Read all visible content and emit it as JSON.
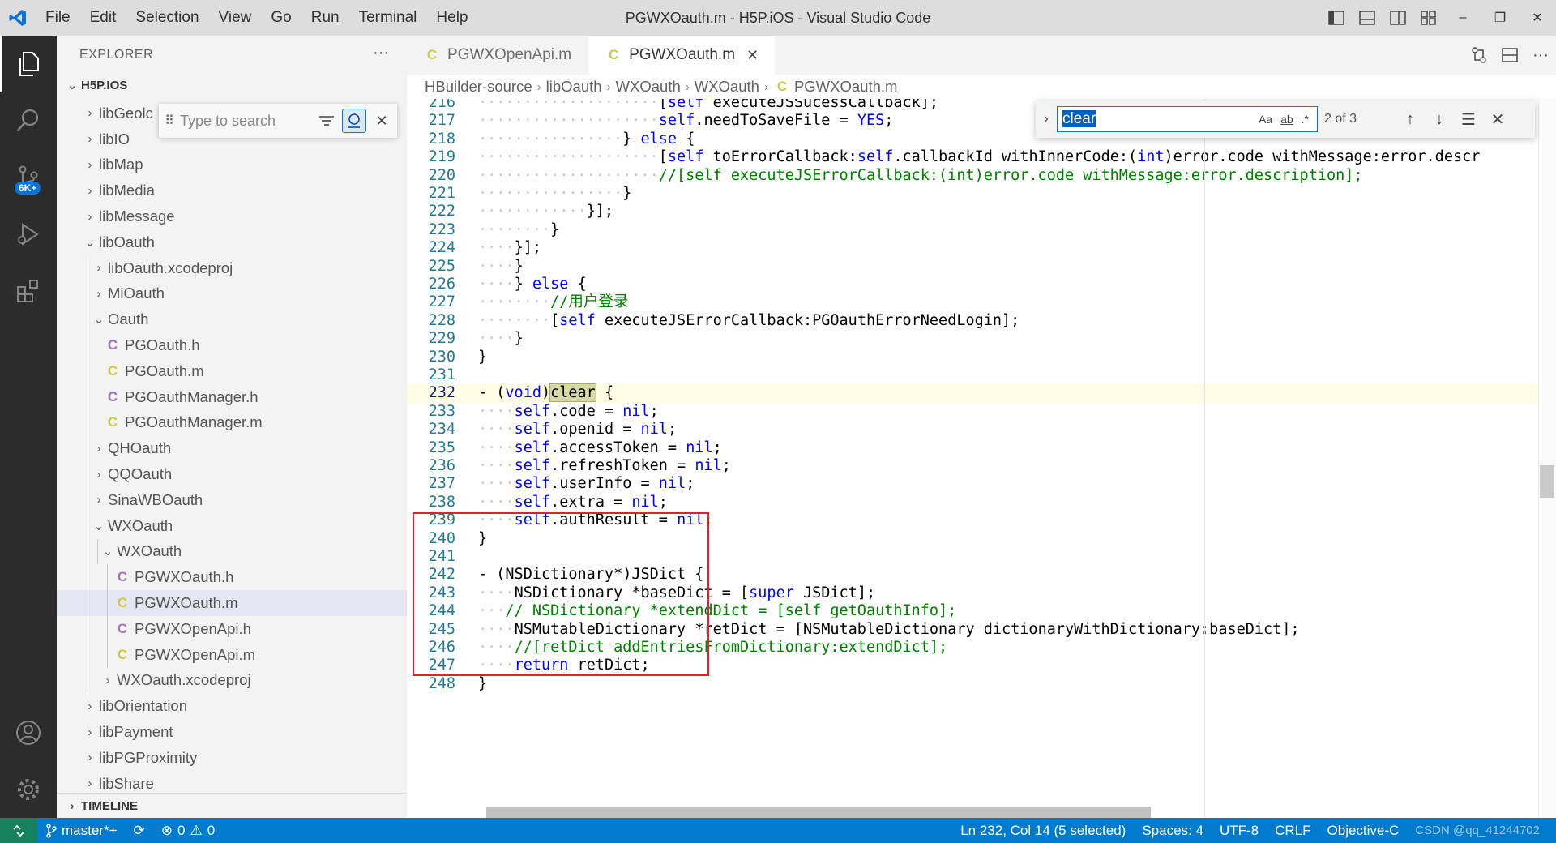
{
  "window": {
    "title": "PGWXOauth.m - H5P.iOS - Visual Studio Code",
    "menu": [
      "File",
      "Edit",
      "Selection",
      "View",
      "Go",
      "Run",
      "Terminal",
      "Help"
    ],
    "controls": {
      "minimize": "–",
      "restore": "❐",
      "close": "✕"
    }
  },
  "activity_bar": {
    "scm_badge": "6K+"
  },
  "sidebar": {
    "title": "EXPLORER",
    "more": "···",
    "root": "H5P.IOS",
    "find": {
      "placeholder": "Type to search"
    },
    "items": [
      {
        "label": "libGeolc",
        "chevron": "›",
        "icon": ""
      },
      {
        "label": "libIO",
        "chevron": "›",
        "icon": ""
      },
      {
        "label": "libMap",
        "chevron": "›",
        "icon": ""
      },
      {
        "label": "libMedia",
        "chevron": "›",
        "icon": ""
      },
      {
        "label": "libMessage",
        "chevron": "›",
        "icon": ""
      },
      {
        "label": "libOauth",
        "chevron": "⌄",
        "icon": ""
      },
      {
        "label": "libOauth.xcodeproj",
        "chevron": "›",
        "icon": ""
      },
      {
        "label": "MiOauth",
        "chevron": "›",
        "icon": ""
      },
      {
        "label": "Oauth",
        "chevron": "⌄",
        "icon": ""
      },
      {
        "label": "PGOauth.h",
        "chevron": "",
        "icon": "C"
      },
      {
        "label": "PGOauth.m",
        "chevron": "",
        "icon": "C"
      },
      {
        "label": "PGOauthManager.h",
        "chevron": "",
        "icon": "C"
      },
      {
        "label": "PGOauthManager.m",
        "chevron": "",
        "icon": "C"
      },
      {
        "label": "QHOauth",
        "chevron": "›",
        "icon": ""
      },
      {
        "label": "QQOauth",
        "chevron": "›",
        "icon": ""
      },
      {
        "label": "SinaWBOauth",
        "chevron": "›",
        "icon": ""
      },
      {
        "label": "WXOauth",
        "chevron": "⌄",
        "icon": ""
      },
      {
        "label": "WXOauth",
        "chevron": "⌄",
        "icon": ""
      },
      {
        "label": "PGWXOauth.h",
        "chevron": "",
        "icon": "C"
      },
      {
        "label": "PGWXOauth.m",
        "chevron": "",
        "icon": "C"
      },
      {
        "label": "PGWXOpenApi.h",
        "chevron": "",
        "icon": "C"
      },
      {
        "label": "PGWXOpenApi.m",
        "chevron": "",
        "icon": "C"
      },
      {
        "label": "WXOauth.xcodeproj",
        "chevron": "›",
        "icon": ""
      },
      {
        "label": "libOrientation",
        "chevron": "›",
        "icon": ""
      },
      {
        "label": "libPayment",
        "chevron": "›",
        "icon": ""
      },
      {
        "label": "libPGProximity",
        "chevron": "›",
        "icon": ""
      },
      {
        "label": "libShare",
        "chevron": "›",
        "icon": ""
      }
    ],
    "timeline": "TIMELINE"
  },
  "tabs": [
    {
      "label": "PGWXOpenApi.m",
      "icon": "C"
    },
    {
      "label": "PGWXOauth.m",
      "icon": "C",
      "close": "✕"
    }
  ],
  "breadcrumb": [
    "HBuilder-source",
    "libOauth",
    "WXOauth",
    "WXOauth",
    "PGWXOauth.m"
  ],
  "breadcrumb_icon": "C",
  "find_widget": {
    "value": "clear",
    "match_case": "Aa",
    "whole_word": "ab",
    "regex": ".*",
    "count": "2 of 3"
  },
  "code": {
    "lines": [
      {
        "n": "216",
        "t": "····················[self executeJSSucessCallback];"
      },
      {
        "n": "217",
        "t": "····················self.needToSaveFile = YES;"
      },
      {
        "n": "218",
        "t": "················} else {"
      },
      {
        "n": "219",
        "t": "····················[self toErrorCallback:self.callbackId withInnerCode:(int)error.code withMessage:error.descr"
      },
      {
        "n": "220",
        "t": "····················//[self executeJSErrorCallback:(int)error.code withMessage:error.description];"
      },
      {
        "n": "221",
        "t": "················}"
      },
      {
        "n": "222",
        "t": "············}];"
      },
      {
        "n": "223",
        "t": "········}"
      },
      {
        "n": "224",
        "t": "····}];"
      },
      {
        "n": "225",
        "t": "····}"
      },
      {
        "n": "226",
        "t": "····} else {"
      },
      {
        "n": "227",
        "t": "········//用户登录"
      },
      {
        "n": "228",
        "t": "········[self executeJSErrorCallback:PGOauthErrorNeedLogin];"
      },
      {
        "n": "229",
        "t": "····}"
      },
      {
        "n": "230",
        "t": "}"
      },
      {
        "n": "231",
        "t": ""
      },
      {
        "n": "232",
        "t": "- (void)clear {"
      },
      {
        "n": "233",
        "t": "····self.code = nil;"
      },
      {
        "n": "234",
        "t": "····self.openid = nil;"
      },
      {
        "n": "235",
        "t": "····self.accessToken = nil;"
      },
      {
        "n": "236",
        "t": "····self.refreshToken = nil;"
      },
      {
        "n": "237",
        "t": "····self.userInfo = nil;"
      },
      {
        "n": "238",
        "t": "····self.extra = nil;"
      },
      {
        "n": "239",
        "t": "····self.authResult = nil;"
      },
      {
        "n": "240",
        "t": "}"
      },
      {
        "n": "241",
        "t": ""
      },
      {
        "n": "242",
        "t": "- (NSDictionary*)JSDict {"
      },
      {
        "n": "243",
        "t": "····NSDictionary *baseDict = [super JSDict];"
      },
      {
        "n": "244",
        "t": "···// NSDictionary *extendDict = [self getOauthInfo];"
      },
      {
        "n": "245",
        "t": "····NSMutableDictionary *retDict = [NSMutableDictionary dictionaryWithDictionary:baseDict];"
      },
      {
        "n": "246",
        "t": "····//[retDict addEntriesFromDictionary:extendDict];"
      },
      {
        "n": "247",
        "t": "····return retDict;"
      },
      {
        "n": "248",
        "t": "}"
      }
    ]
  },
  "statusbar": {
    "branch": "master*+",
    "errors": "0",
    "warnings": "0",
    "position": "Ln 232, Col 14 (5 selected)",
    "spaces": "Spaces: 4",
    "encoding": "UTF-8",
    "eol": "CRLF",
    "language": "Objective-C",
    "watermark": "CSDN @qq_41244702"
  },
  "colors": {
    "status_bar": "#007acc",
    "activity_bar": "#2c2c2c",
    "highlight_box": "#e0202a",
    "keyword": "#0000ff",
    "comment": "#008000"
  }
}
